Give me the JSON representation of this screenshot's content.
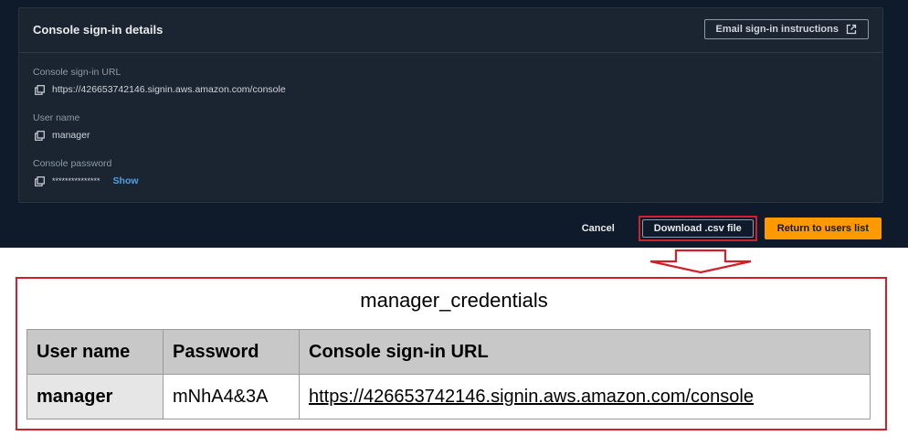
{
  "panel": {
    "title": "Console sign-in details",
    "email_button": "Email sign-in instructions",
    "fields": {
      "url_label": "Console sign-in URL",
      "url_value": "https://426653742146.signin.aws.amazon.com/console",
      "username_label": "User name",
      "username_value": "manager",
      "password_label": "Console password",
      "password_value": "***************",
      "show_label": "Show"
    }
  },
  "actions": {
    "cancel": "Cancel",
    "download": "Download .csv file",
    "return": "Return to users list"
  },
  "csv_preview": {
    "title": "manager_credentials",
    "headers": [
      "User name",
      "Password",
      "Console sign-in URL"
    ],
    "row": [
      "manager",
      "mNhA4&3A",
      "https://426653742146.signin.aws.amazon.com/console"
    ]
  },
  "colors": {
    "console_bg": "#0f1b2a",
    "panel_bg": "#1b2532",
    "accent_orange": "#ff9900",
    "link_blue": "#539fe5",
    "highlight_red": "#d0212a"
  }
}
